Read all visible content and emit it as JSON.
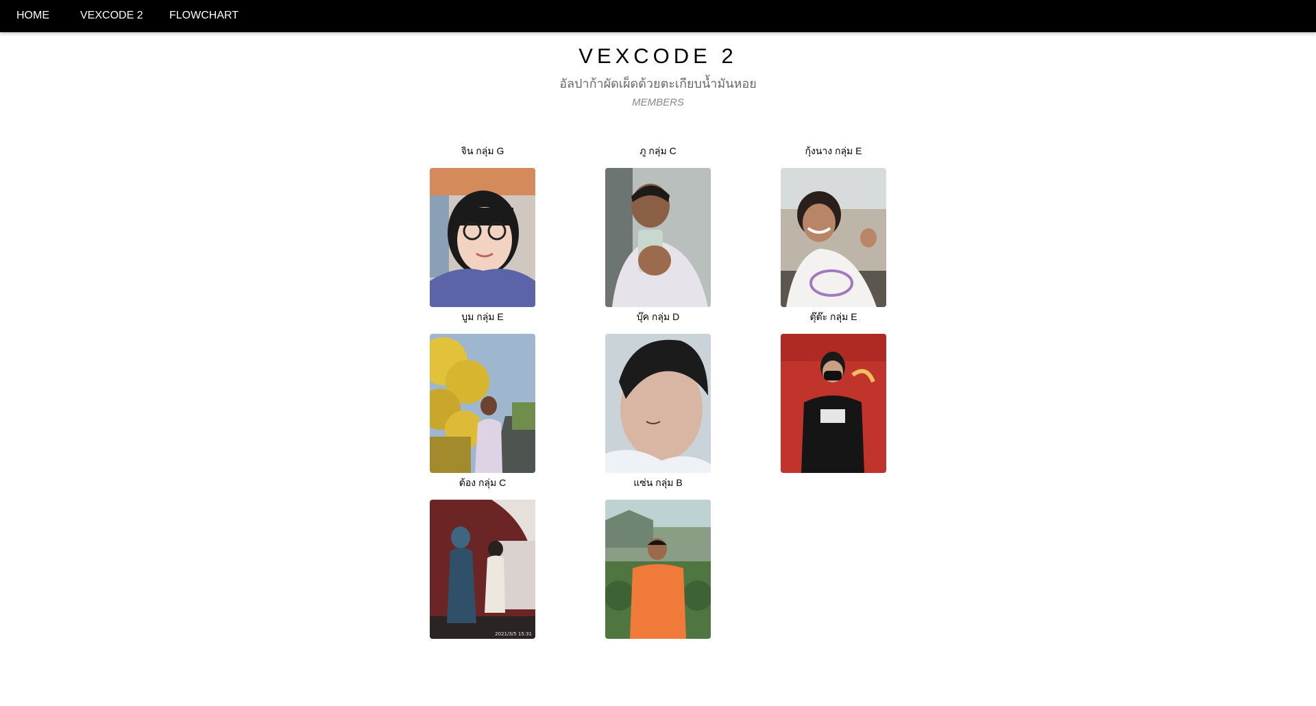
{
  "nav": {
    "home_label": "HOME",
    "vexcode_label": "VEXCODE 2",
    "flowchart_label": "FLOWCHART"
  },
  "header": {
    "title": "VEXCODE 2",
    "subtitle": "อัลปาก้าผัดเผ็ดด้วยตะเกียบน้ำมันหอย",
    "section_label": "MEMBERS"
  },
  "members": [
    {
      "name": "จิน กลุ่ม G",
      "photo_icon": "member-photo-glasses-girl"
    },
    {
      "name": "ภู กลุ่ม C",
      "photo_icon": "member-photo-mirror-selfie"
    },
    {
      "name": "กุ้งนาง กลุ่ม E",
      "photo_icon": "member-photo-beach-girl"
    },
    {
      "name": "บูม กลุ่ม E",
      "photo_icon": "member-photo-yellow-trees"
    },
    {
      "name": "บุ๊ค กลุ่ม D",
      "photo_icon": "member-photo-closeup"
    },
    {
      "name": "ตุ๊ต๊ะ กลุ่ม E",
      "photo_icon": "member-photo-red-wall"
    },
    {
      "name": "ต้อง กลุ่ม C",
      "photo_icon": "member-photo-monster-statue"
    },
    {
      "name": "แซ่น กลุ่ม B",
      "photo_icon": "member-photo-orange-shirt"
    }
  ],
  "photo_timestamp": "2021/3/5 15:31",
  "colors": {
    "navbar_bg": "#000000",
    "nav_text": "#ffffff",
    "subtitle": "#666666",
    "section_label": "#888888"
  }
}
